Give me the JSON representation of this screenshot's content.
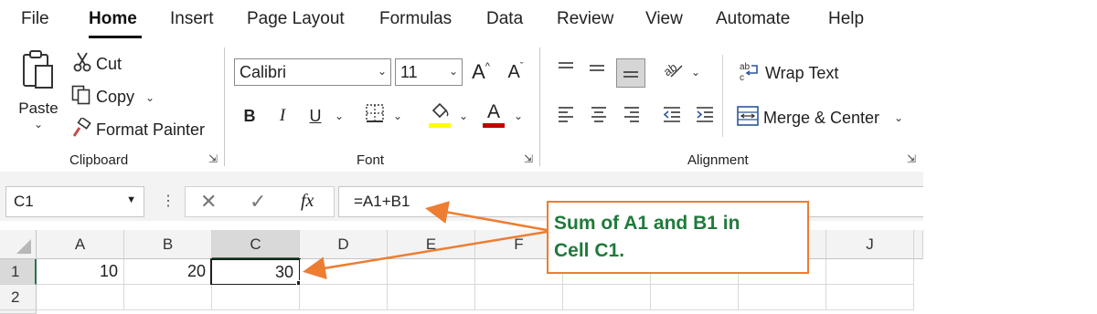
{
  "menu": {
    "tabs": [
      "File",
      "Home",
      "Insert",
      "Page Layout",
      "Formulas",
      "Data",
      "Review",
      "View",
      "Automate",
      "Help"
    ],
    "active": "Home"
  },
  "clipboard": {
    "paste_label": "Paste",
    "cut_label": "Cut",
    "copy_label": "Copy",
    "format_painter_label": "Format Painter",
    "group_label": "Clipboard"
  },
  "font": {
    "font_name": "Calibri",
    "font_size": "11",
    "bold": "B",
    "italic": "I",
    "underline": "U",
    "group_label": "Font",
    "grow_label": "A",
    "shrink_label": "A",
    "font_color_label": "A",
    "fill_color": "#ffff00",
    "text_color": "#c00000"
  },
  "alignment": {
    "wrap_text_label": "Wrap Text",
    "merge_center_label": "Merge & Center",
    "group_label": "Alignment"
  },
  "formula_bar": {
    "name_box": "C1",
    "fx_label": "fx",
    "formula": "=A1+B1"
  },
  "sheet": {
    "columns": [
      "A",
      "B",
      "C",
      "D",
      "E",
      "F",
      "J"
    ],
    "rows": [
      "1",
      "2"
    ],
    "cells": {
      "A1": "10",
      "B1": "20",
      "C1": "30"
    },
    "selected_cell": "C1"
  },
  "annotation": {
    "text_line1": "Sum of A1 and B1 in",
    "text_line2": "Cell C1.",
    "border_color": "#ed7d31",
    "text_color": "#1f7a3a"
  }
}
